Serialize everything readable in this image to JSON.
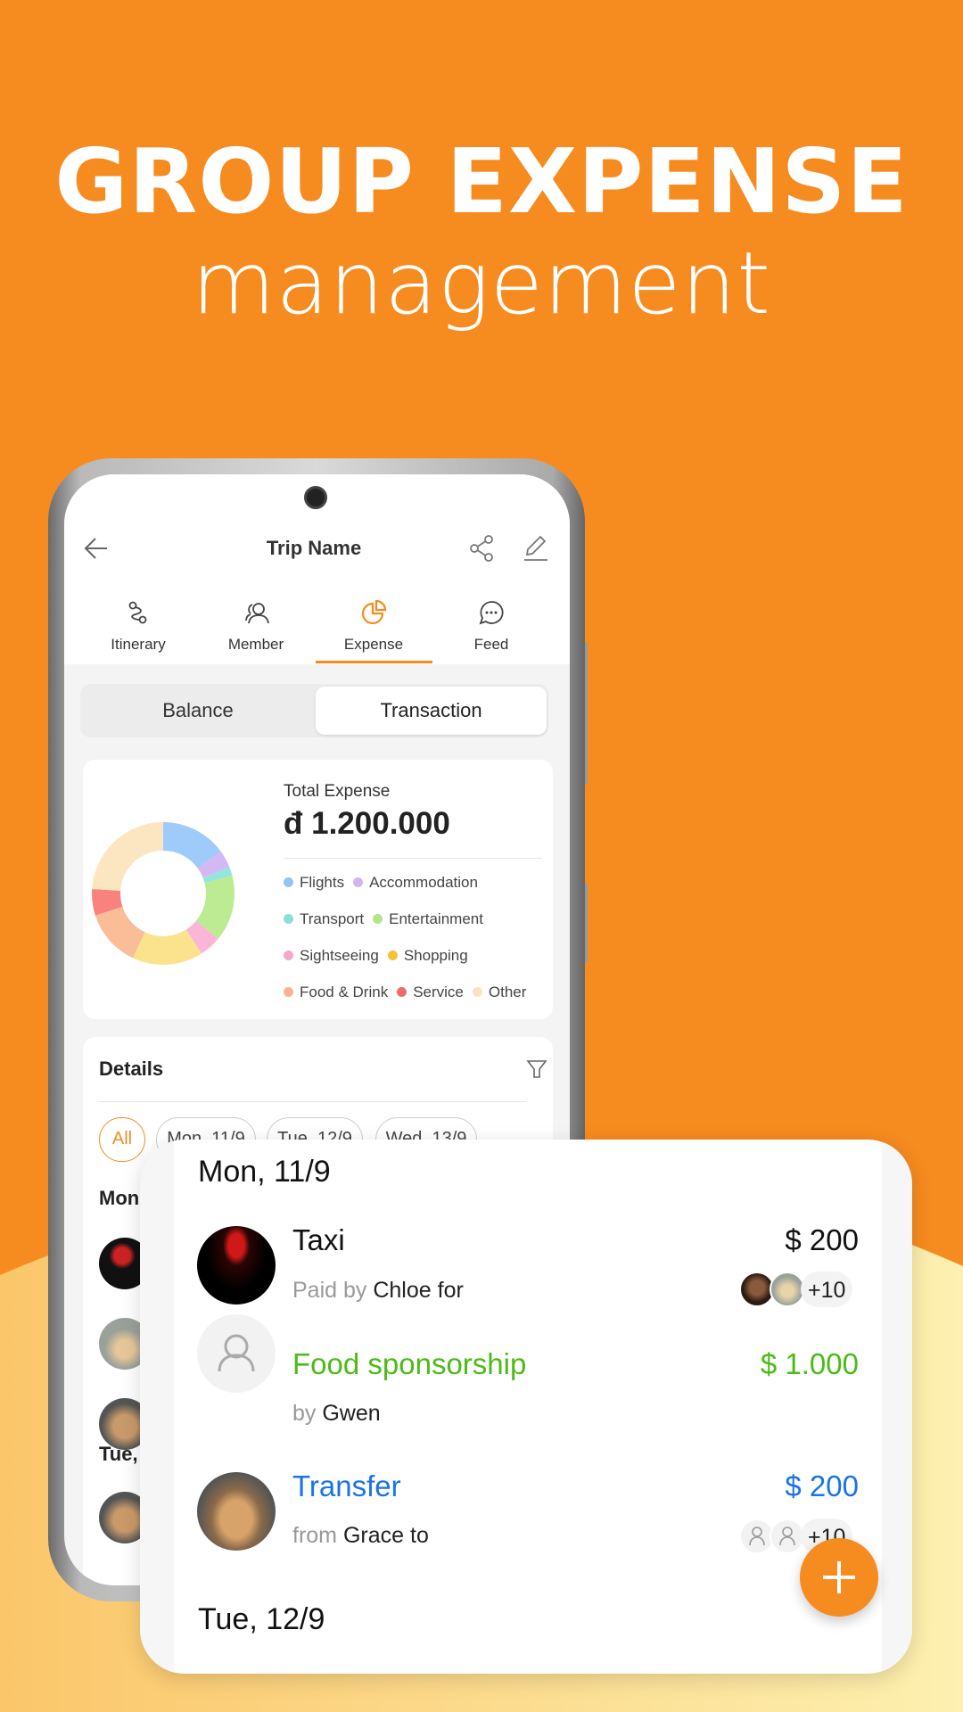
{
  "hero": {
    "title": "GROUP EXPENSE",
    "subtitle": "management"
  },
  "colors": {
    "brand": "#F68B1F",
    "income": "#4CBB17",
    "transfer": "#1A73E8"
  },
  "header": {
    "title": "Trip Name",
    "back_icon": "arrow-left-icon",
    "share_icon": "share-icon",
    "edit_icon": "pencil-icon"
  },
  "tabs": [
    {
      "label": "Itinerary",
      "icon": "route-icon"
    },
    {
      "label": "Member",
      "icon": "users-icon"
    },
    {
      "label": "Expense",
      "icon": "pie-chart-icon",
      "active": true
    },
    {
      "label": "Feed",
      "icon": "chat-bubble-icon"
    }
  ],
  "segmented": {
    "options": [
      "Balance",
      "Transaction"
    ],
    "selected": "Transaction"
  },
  "summary": {
    "label": "Total Expense",
    "amount": "đ 1.200.000"
  },
  "chart_data": {
    "type": "pie",
    "donut": true,
    "categories": [
      "Flights",
      "Accommodation",
      "Transport",
      "Entertainment",
      "Sightseeing",
      "Shopping",
      "Food & Drink",
      "Service",
      "Other"
    ],
    "values": [
      15,
      4,
      2,
      15,
      5,
      16,
      13,
      6,
      24
    ],
    "colors": [
      "#9ECBFA",
      "#D4B8F5",
      "#92E6DC",
      "#BCEB93",
      "#F9B6D6",
      "#FBE38E",
      "#FBBC98",
      "#F9827F",
      "#FCE6C2"
    ],
    "legend_dots": [
      "#93C4F8",
      "#D2B4F3",
      "#8BE0D6",
      "#B3E68A",
      "#F6A8CB",
      "#F6C235",
      "#F9B391",
      "#F26B6B",
      "#FBE3C0"
    ]
  },
  "details": {
    "title": "Details",
    "filter_icon": "filter-icon",
    "chips": [
      "All",
      "Mon, 11/9",
      "Tue, 12/9",
      "Wed, 13/9"
    ],
    "selected_chip": "All",
    "peek_date": "Mon",
    "peek_date2": "Tue,"
  },
  "feed": {
    "day1": "Mon, 11/9",
    "day2": "Tue, 12/9",
    "items": [
      {
        "title": "Taxi",
        "amount": "$ 200",
        "prefix": "Paid by",
        "name": "Chloe",
        "suffix": "for",
        "extra": "+10",
        "kind": "expense"
      },
      {
        "title": "Food sponsorship",
        "amount": "$ 1.000",
        "prefix": "by",
        "name": "Gwen",
        "suffix": "",
        "kind": "income"
      },
      {
        "title": "Transfer",
        "amount": "$ 200",
        "prefix": "from",
        "name": "Grace",
        "suffix": "to",
        "extra": "+10",
        "kind": "transfer"
      }
    ]
  },
  "fab": {
    "icon": "plus-icon"
  }
}
